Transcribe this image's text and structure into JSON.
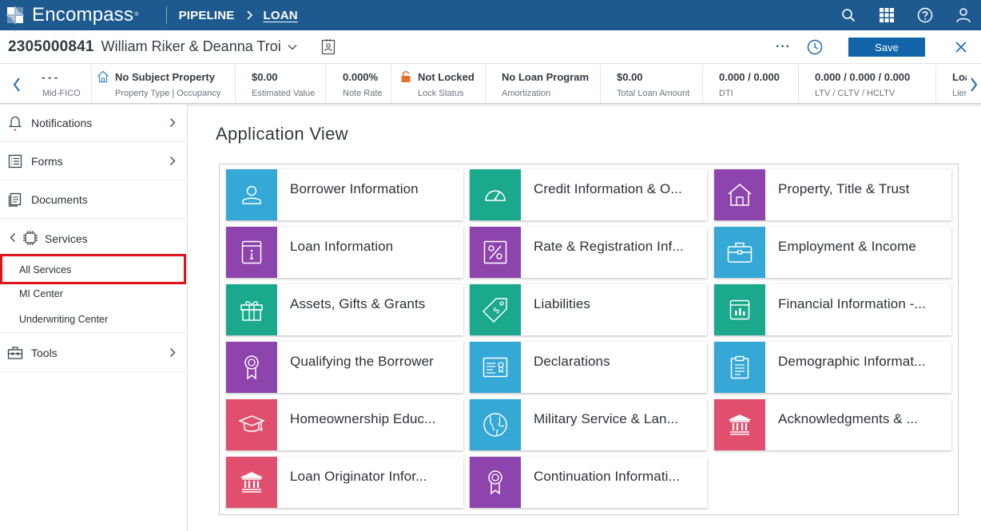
{
  "topnav": {
    "brand": "Encompass",
    "brand_mark": "®",
    "links": [
      "PIPELINE",
      "LOAN"
    ],
    "icons": [
      "search-icon",
      "apps-grid-icon",
      "help-icon",
      "user-icon"
    ]
  },
  "loan": {
    "number": "2305000841",
    "borrower": "William Riker & Deanna Troi",
    "save_label": "Save",
    "more_label": "···"
  },
  "metrics": [
    {
      "value": "- - -",
      "label": "Mid-FICO"
    },
    {
      "value": "No Subject Property",
      "label": "Property Type | Occupancy",
      "icon": "home-icon"
    },
    {
      "value": "$0.00",
      "label": "Estimated Value"
    },
    {
      "value": "0.000%",
      "label": "Note Rate"
    },
    {
      "value": "Not Locked",
      "label": "Lock Status",
      "icon": "lock-icon"
    },
    {
      "value": "No Loan Program",
      "label": "Amortization"
    },
    {
      "value": "$0.00",
      "label": "Total Loan Amount"
    },
    {
      "value": "0.000 / 0.000",
      "label": "DTI"
    },
    {
      "value": "0.000 / 0.000 / 0.000",
      "label": "LTV / CLTV / HCLTV"
    },
    {
      "value": "Loa",
      "label": "Lier"
    }
  ],
  "leftnav": {
    "items": [
      {
        "label": "Notifications",
        "icon": "bell-icon"
      },
      {
        "label": "Forms",
        "icon": "form-icon"
      },
      {
        "label": "Documents",
        "icon": "documents-icon"
      },
      {
        "label": "Services",
        "icon": "chip-icon"
      },
      {
        "label": "Tools",
        "icon": "toolbox-icon"
      }
    ],
    "services_sub": [
      "All Services",
      "MI Center",
      "Underwriting Center"
    ],
    "selected": "All Services"
  },
  "main": {
    "title": "Application View",
    "tiles": [
      {
        "label": "Borrower Information",
        "color": "#35a8d6",
        "icon": "person-icon"
      },
      {
        "label": "Credit Information & O...",
        "color": "#1aa98c",
        "icon": "gauge-icon"
      },
      {
        "label": "Property, Title & Trust",
        "color": "#8e44ad",
        "icon": "house-icon"
      },
      {
        "label": "Loan Information",
        "color": "#8e44ad",
        "icon": "info-icon"
      },
      {
        "label": "Rate & Registration Inf...",
        "color": "#8e44ad",
        "icon": "percent-icon"
      },
      {
        "label": "Employment & Income",
        "color": "#35a8d6",
        "icon": "briefcase-icon"
      },
      {
        "label": "Assets, Gifts & Grants",
        "color": "#1aa98c",
        "icon": "gift-icon"
      },
      {
        "label": "Liabilities",
        "color": "#1aa98c",
        "icon": "price-tag-icon"
      },
      {
        "label": "Financial Information -...",
        "color": "#1aa98c",
        "icon": "chart-icon"
      },
      {
        "label": "Qualifying the Borrower",
        "color": "#8e44ad",
        "icon": "ribbon-icon"
      },
      {
        "label": "Declarations",
        "color": "#35a8d6",
        "icon": "id-card-icon"
      },
      {
        "label": "Demographic Informat...",
        "color": "#35a8d6",
        "icon": "clipboard-icon"
      },
      {
        "label": "Homeownership Educ...",
        "color": "#e0506e",
        "icon": "graduation-cap-icon"
      },
      {
        "label": "Military Service & Lan...",
        "color": "#35a8d6",
        "icon": "globe-icon"
      },
      {
        "label": "Acknowledgments & ...",
        "color": "#e0506e",
        "icon": "bank-icon"
      },
      {
        "label": "Loan Originator Infor...",
        "color": "#e0506e",
        "icon": "bank-icon"
      },
      {
        "label": "Continuation Informati...",
        "color": "#8e44ad",
        "icon": "ribbon-icon"
      }
    ]
  }
}
